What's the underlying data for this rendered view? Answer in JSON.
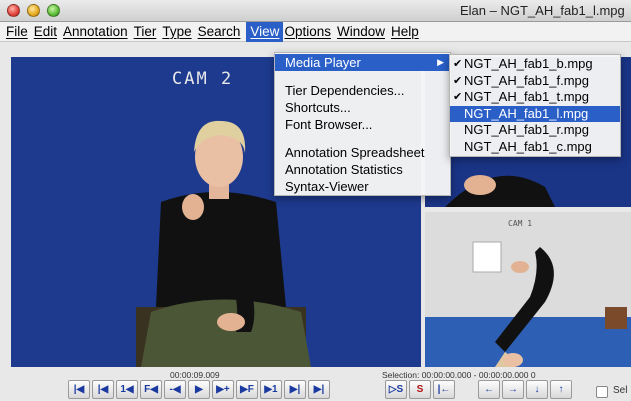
{
  "window": {
    "title": "Elan – NGT_AH_fab1_l.mpg"
  },
  "menubar": [
    "File",
    "Edit",
    "Annotation",
    "Tier",
    "Type",
    "Search",
    "View",
    "Options",
    "Window",
    "Help"
  ],
  "view_menu": {
    "items": [
      {
        "label": "Media Player",
        "highlighted": true,
        "submenu": true
      },
      {
        "label": "Tier Dependencies..."
      },
      {
        "label": "Shortcuts..."
      },
      {
        "label": "Font Browser..."
      },
      {
        "label": "Annotation Spreadsheet"
      },
      {
        "label": "Annotation Statistics"
      },
      {
        "label": "Syntax-Viewer"
      }
    ]
  },
  "media_submenu": {
    "items": [
      {
        "label": "NGT_AH_fab1_b.mpg",
        "checked": true
      },
      {
        "label": "NGT_AH_fab1_f.mpg",
        "checked": true
      },
      {
        "label": "NGT_AH_fab1_t.mpg",
        "checked": true
      },
      {
        "label": "NGT_AH_fab1_l.mpg",
        "highlighted": true
      },
      {
        "label": "NGT_AH_fab1_r.mpg"
      },
      {
        "label": "NGT_AH_fab1_c.mpg"
      }
    ]
  },
  "videos": {
    "main_label": "CAM 2",
    "small_label": "CAM 1"
  },
  "status": {
    "timecode": "00:00:09.009",
    "selection": "Selection: 00:00:00.000 - 00:00:00.000  0"
  },
  "controls": {
    "playback": [
      "|◀",
      "|◀",
      "1◀",
      "F◀",
      "-◀",
      "▶",
      "▶+",
      "▶F",
      "▶1",
      "▶|",
      "▶|"
    ],
    "selection": [
      "▷S",
      "S",
      "|←"
    ],
    "arrows": [
      "←",
      "→",
      "↓",
      "↑"
    ],
    "checkbox_label": "Sel"
  },
  "colors": {
    "highlight": "#2a5fc8",
    "video_bg": "#1d3a8e"
  }
}
